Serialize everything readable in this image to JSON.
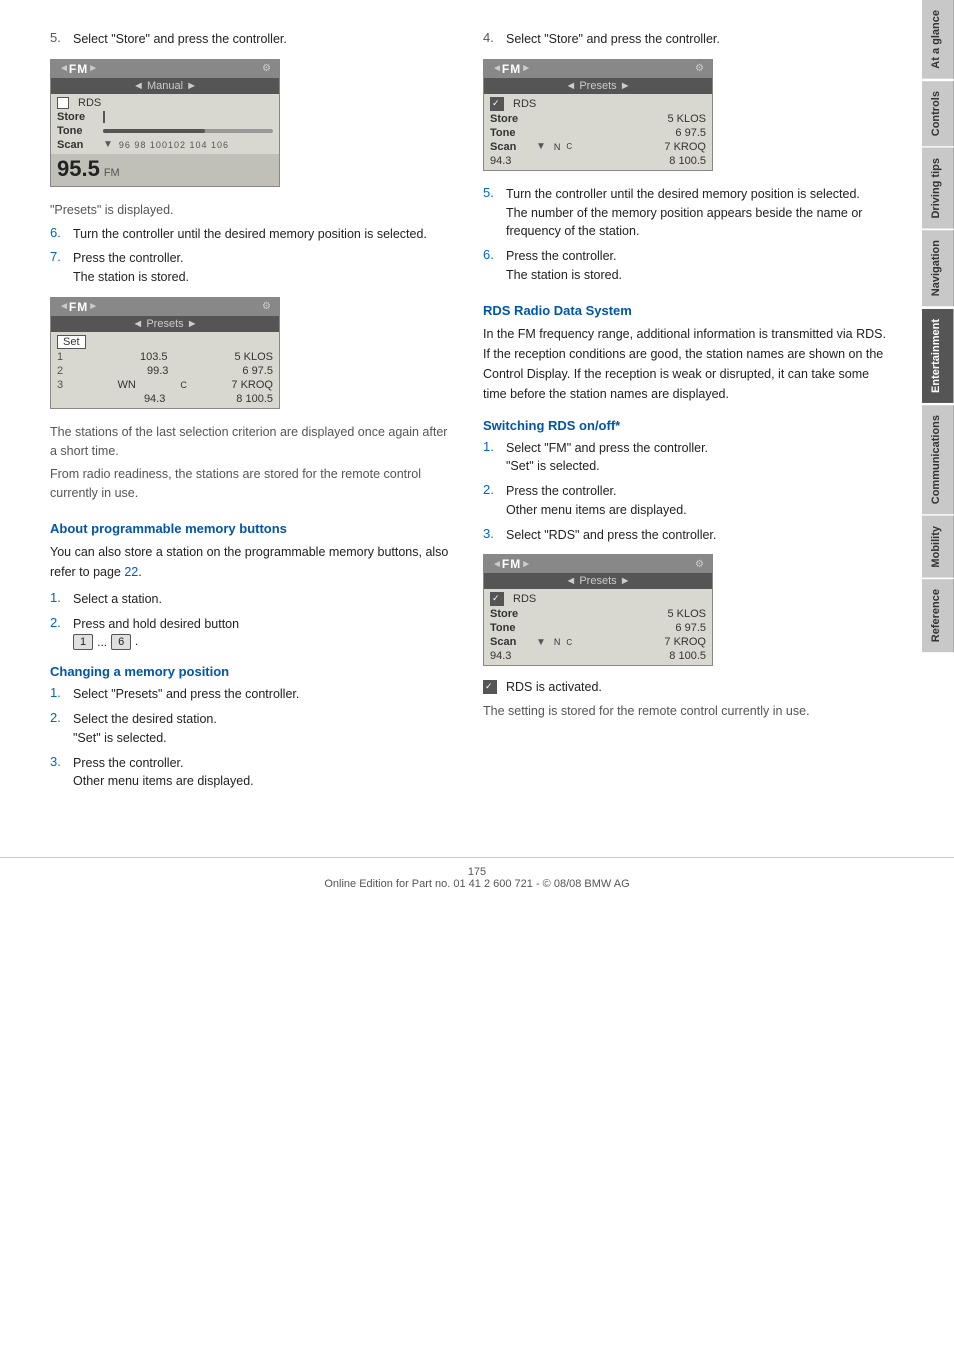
{
  "page": {
    "number": "175",
    "footer_text": "Online Edition for Part no. 01 41 2 600 721 - © 08/08 BMW AG"
  },
  "side_tabs": [
    {
      "id": "at-a-glance",
      "label": "At a glance",
      "active": false
    },
    {
      "id": "controls",
      "label": "Controls",
      "active": false
    },
    {
      "id": "driving-tips",
      "label": "Driving tips",
      "active": false
    },
    {
      "id": "navigation",
      "label": "Navigation",
      "active": false
    },
    {
      "id": "entertainment",
      "label": "Entertainment",
      "active": true
    },
    {
      "id": "communications",
      "label": "Communications",
      "active": false
    },
    {
      "id": "mobility",
      "label": "Mobility",
      "active": false
    },
    {
      "id": "reference",
      "label": "Reference",
      "active": false
    }
  ],
  "left_col": {
    "step5_top": {
      "number": "5.",
      "text": "Select \"Store\" and press the controller."
    },
    "display1": {
      "top_bar": "◄ FM ►",
      "nav_bar": "◄ Manual ►",
      "rows": [
        {
          "icon": "checkbox",
          "label": "RDS",
          "value": ""
        },
        {
          "label": "Store",
          "value": "",
          "highlight": false
        },
        {
          "label": "Tone",
          "freq_bar": true
        },
        {
          "label": "Scan",
          "arrow": "▼",
          "freq_text": "96  98  100 102 104 106"
        }
      ],
      "freq_big": "95.5",
      "freq_sub": "FM"
    },
    "note_presets": "\"Presets\" is displayed.",
    "step6": {
      "number": "6.",
      "text": "Turn the controller until the desired memory position is selected."
    },
    "step7": {
      "number": "7.",
      "text": "Press the controller.",
      "sub_text": "The station is stored."
    },
    "display2": {
      "top_bar": "◄ FM ►",
      "nav_bar": "◄ Presets ►",
      "set_row": "Set",
      "rows": [
        {
          "num": "1",
          "freq": "103.5",
          "name": "5 KLOS"
        },
        {
          "num": "2",
          "freq": "99.3",
          "name": "6 97.5"
        },
        {
          "num": "3",
          "freq": "WN",
          "sub": "C",
          "name": "7 KROQ"
        },
        {
          "num": "",
          "freq": "94.3",
          "name": "8 100.5"
        }
      ]
    },
    "note_stations": "The stations of the last selection criterion are displayed once again after a short time.",
    "note_radio": "From radio readiness, the stations are stored for the remote control currently in use.",
    "section_programmable": {
      "heading": "About programmable memory buttons",
      "body": "You can also store a station on the programmable memory buttons, also refer to page 22.",
      "link_page": "22",
      "steps": [
        {
          "number": "1.",
          "text": "Select a station."
        },
        {
          "number": "2.",
          "text": "Press and hold desired button"
        }
      ],
      "button_seq": [
        "1",
        "...",
        "6"
      ]
    },
    "section_changing": {
      "heading": "Changing a memory position",
      "steps": [
        {
          "number": "1.",
          "text": "Select \"Presets\" and press the controller."
        },
        {
          "number": "2.",
          "text": "Select the desired station.\n\"Set\" is selected."
        },
        {
          "number": "3.",
          "text": "Press the controller.\nOther menu items are displayed."
        }
      ]
    }
  },
  "right_col": {
    "step4_top": {
      "number": "4.",
      "text": "Select \"Store\" and press the controller."
    },
    "display3": {
      "top_bar": "◄ FM ►",
      "nav_bar": "◄ Presets ►",
      "rows": [
        {
          "icon": "rds-check",
          "label": "RDS",
          "value": ""
        },
        {
          "label": "Store",
          "value": "5 KLOS",
          "highlight": false
        },
        {
          "label": "Tone",
          "value": "6 97.5"
        },
        {
          "label": "Scan",
          "arrow": "▼",
          "sub": "N C",
          "value": "7 KROQ"
        },
        {
          "num": "",
          "value": "8 100.5"
        }
      ]
    },
    "step5": {
      "number": "5.",
      "text": "Turn the controller until the desired memory position is selected.",
      "sub_text": "The number of the memory position appears beside the name or frequency of the station."
    },
    "step6": {
      "number": "6.",
      "text": "Press the controller.",
      "sub_text": "The station is stored."
    },
    "section_rds": {
      "heading": "RDS Radio Data System",
      "body": "In the FM frequency range, additional information is transmitted via RDS. If the reception conditions are good, the station names are shown on the Control Display. If the reception is weak or disrupted, it can take some time before the station names are displayed."
    },
    "section_switching": {
      "heading": "Switching RDS on/off*",
      "steps": [
        {
          "number": "1.",
          "text": "Select \"FM\" and press the controller.\n\"Set\" is selected."
        },
        {
          "number": "2.",
          "text": "Press the controller.\nOther menu items are displayed."
        },
        {
          "number": "3.",
          "text": "Select \"RDS\" and press the controller."
        }
      ]
    },
    "display4": {
      "top_bar": "◄ FM ►",
      "nav_bar": "◄ Presets ►",
      "rows": [
        {
          "icon": "rds-check",
          "label": "RDS",
          "value": ""
        },
        {
          "label": "Store",
          "value": "5 KLOS",
          "highlight": false
        },
        {
          "label": "Tone",
          "value": "6 97.5"
        },
        {
          "label": "Scan",
          "arrow": "▼",
          "sub": "N C",
          "value": "7 KROQ"
        },
        {
          "num": "",
          "value": "8 100.5"
        }
      ]
    },
    "rds_activated": "RDS is activated.",
    "note_setting": "The setting is stored for the remote control currently in use."
  }
}
